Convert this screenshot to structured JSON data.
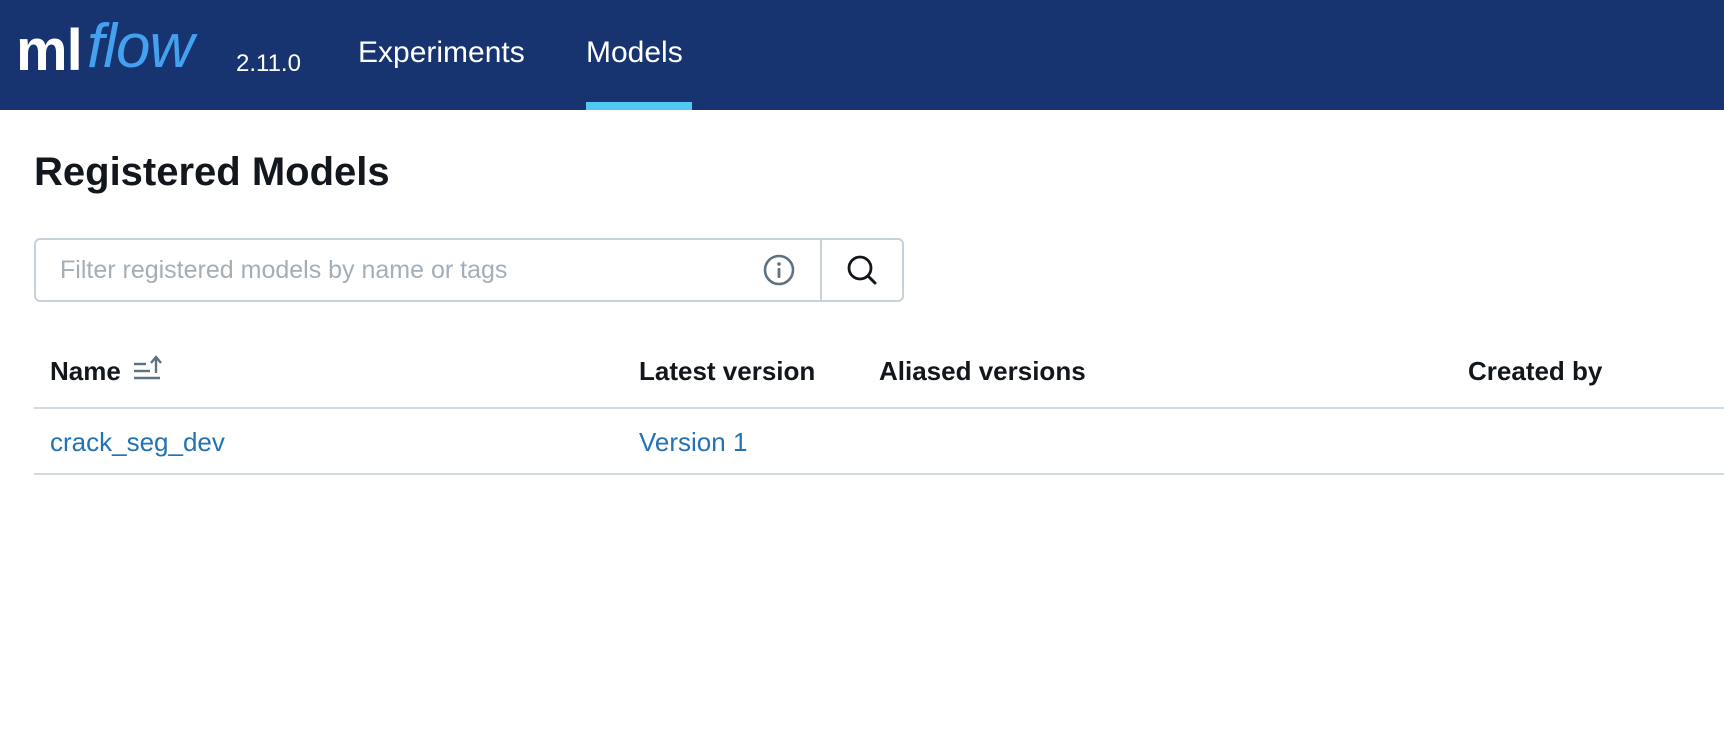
{
  "header": {
    "logo_ml": "ml",
    "logo_flow": "flow",
    "version": "2.11.0",
    "nav": [
      {
        "label": "Experiments",
        "active": false
      },
      {
        "label": "Models",
        "active": true
      }
    ],
    "background_color": "#173470",
    "accent_color": "#52c7f2"
  },
  "page": {
    "title": "Registered Models"
  },
  "search": {
    "placeholder": "Filter registered models by name or tags",
    "value": "",
    "info_icon": "info-circle-icon",
    "search_icon": "magnifier-icon"
  },
  "table": {
    "columns": [
      "Name",
      "Latest version",
      "Aliased versions",
      "Created by"
    ],
    "sort_icon": "sort-ascending-icon",
    "rows": [
      {
        "name": "crack_seg_dev",
        "latest_version": "Version 1",
        "aliased_versions": "",
        "created_by": ""
      }
    ],
    "link_color": "#2272b4"
  }
}
